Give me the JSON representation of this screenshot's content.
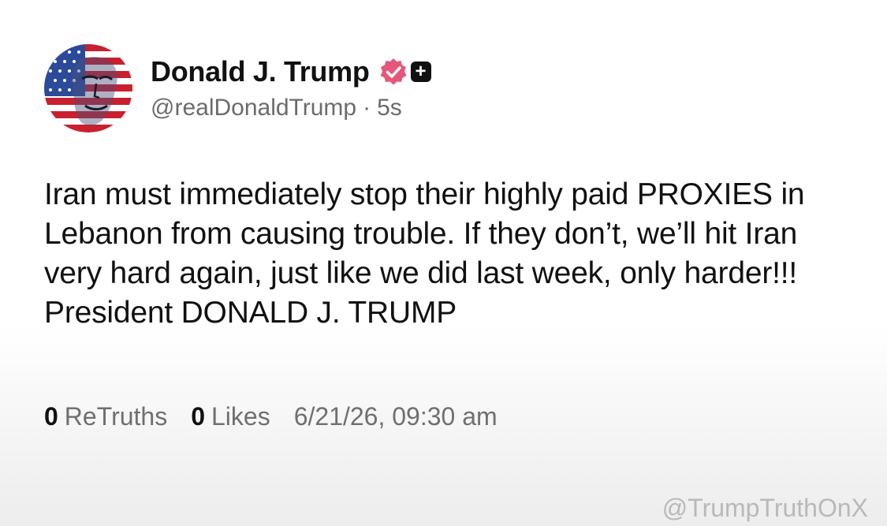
{
  "post": {
    "author": {
      "display_name": "Donald J. Trump",
      "handle": "@realDonaldTrump",
      "separator": "·",
      "time_ago": "5s",
      "verified_icon": "verified-badge-icon",
      "plus_icon_glyph": "+",
      "avatar_icon": "flag-face-avatar"
    },
    "text": "Iran must immediately stop their highly paid PROXIES in Lebanon from causing trouble. If they don’t, we’ll hit Iran very hard again, just like we did last week, only harder!!! President DONALD J. TRUMP",
    "stats": {
      "retruths_count": "0",
      "retruths_label": "ReTruths",
      "likes_count": "0",
      "likes_label": "Likes",
      "timestamp": "6/21/26, 09:30 am"
    }
  },
  "watermark": "@TrumpTruthOnX",
  "colors": {
    "verified_badge": "#e6577c",
    "text_primary": "#111111",
    "text_secondary": "#6b6b6b",
    "watermark": "#b9b9b9"
  }
}
